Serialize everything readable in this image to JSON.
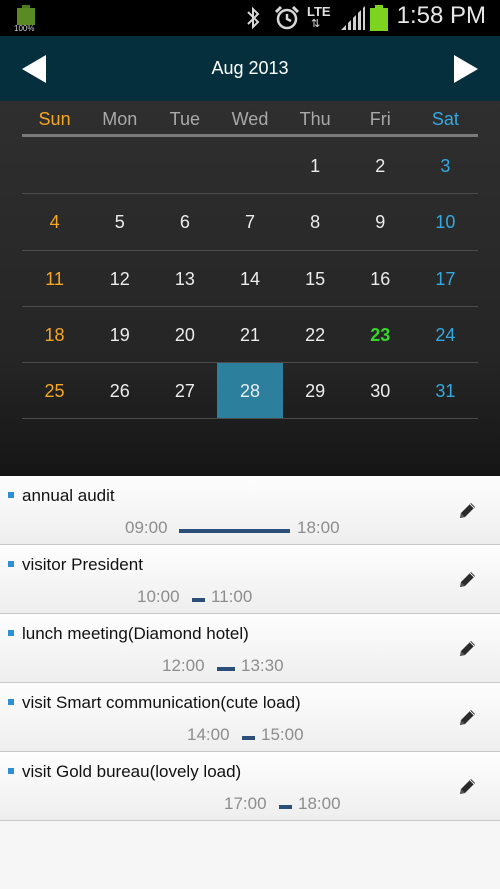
{
  "status_bar": {
    "battery_percent_label": "100%",
    "network_label": "LTE",
    "network_arrows": "⇅",
    "time": "1:58 PM"
  },
  "header": {
    "month_title": "Aug 2013",
    "prev_icon": "triangle-left-icon",
    "next_icon": "triangle-right-icon"
  },
  "colors": {
    "header_bg": "#062f3d",
    "sunday": "#f5a623",
    "saturday": "#33a9e0",
    "today": "#37d629",
    "selected_bg": "#2d7f9e",
    "event_bar": "#2b4e7a",
    "event_dot": "#2f8fd6"
  },
  "calendar": {
    "weekdays": [
      "Sun",
      "Mon",
      "Tue",
      "Wed",
      "Thu",
      "Fri",
      "Sat"
    ],
    "weeks": [
      [
        "",
        "",
        "",
        "",
        "1",
        "2",
        "3"
      ],
      [
        "4",
        "5",
        "6",
        "7",
        "8",
        "9",
        "10"
      ],
      [
        "11",
        "12",
        "13",
        "14",
        "15",
        "16",
        "17"
      ],
      [
        "18",
        "19",
        "20",
        "21",
        "22",
        "23",
        "24"
      ],
      [
        "25",
        "26",
        "27",
        "28",
        "29",
        "30",
        "31"
      ]
    ],
    "today": "23",
    "selected": "28"
  },
  "events": [
    {
      "title": "annual audit",
      "start": "09:00",
      "end": "18:00",
      "edit_icon": "pencil-icon"
    },
    {
      "title": "visitor President",
      "start": "10:00",
      "end": "11:00",
      "edit_icon": "pencil-icon"
    },
    {
      "title": "lunch meeting(Diamond hotel)",
      "start": "12:00",
      "end": "13:30",
      "edit_icon": "pencil-icon"
    },
    {
      "title": "visit Smart communication(cute load)",
      "start": "14:00",
      "end": "15:00",
      "edit_icon": "pencil-icon"
    },
    {
      "title": "visit Gold bureau(lovely load)",
      "start": "17:00",
      "end": "18:00",
      "edit_icon": "pencil-icon"
    }
  ]
}
